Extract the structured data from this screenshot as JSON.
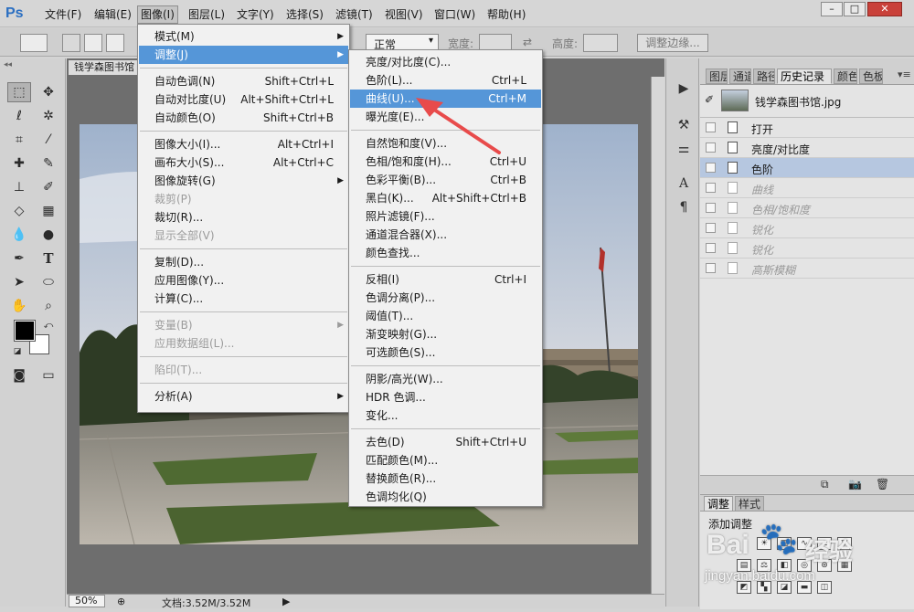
{
  "app": {
    "logo": "Ps"
  },
  "menubar": {
    "items": [
      "文件(F)",
      "编辑(E)",
      "图像(I)",
      "图层(L)",
      "文字(Y)",
      "选择(S)",
      "滤镜(T)",
      "视图(V)",
      "窗口(W)",
      "帮助(H)"
    ],
    "active": "图像(I)"
  },
  "window_controls": {
    "minimize": "–",
    "maximize": "□",
    "close": "✕"
  },
  "options_bar": {
    "style_value": "正常",
    "width_label": "宽度:",
    "height_label": "高度:",
    "refine_edge": "调整边缘..."
  },
  "document": {
    "tab_title": "钱学森图书馆",
    "zoom": "50%",
    "doc_info": "文档:3.52M/3.52M"
  },
  "image_menu": {
    "items": [
      {
        "label": "模式(M)",
        "submenu": true
      },
      {
        "label": "调整(J)",
        "submenu": true,
        "highlighted": true
      },
      {
        "separator": true
      },
      {
        "label": "自动色调(N)",
        "shortcut": "Shift+Ctrl+L"
      },
      {
        "label": "自动对比度(U)",
        "shortcut": "Alt+Shift+Ctrl+L"
      },
      {
        "label": "自动颜色(O)",
        "shortcut": "Shift+Ctrl+B"
      },
      {
        "separator": true
      },
      {
        "label": "图像大小(I)...",
        "shortcut": "Alt+Ctrl+I"
      },
      {
        "label": "画布大小(S)...",
        "shortcut": "Alt+Ctrl+C"
      },
      {
        "label": "图像旋转(G)",
        "submenu": true
      },
      {
        "label": "裁剪(P)",
        "disabled": true
      },
      {
        "label": "裁切(R)..."
      },
      {
        "label": "显示全部(V)",
        "disabled": true
      },
      {
        "separator": true
      },
      {
        "label": "复制(D)..."
      },
      {
        "label": "应用图像(Y)..."
      },
      {
        "label": "计算(C)..."
      },
      {
        "separator": true
      },
      {
        "label": "变量(B)",
        "submenu": true,
        "disabled": true
      },
      {
        "label": "应用数据组(L)...",
        "disabled": true
      },
      {
        "separator": true
      },
      {
        "label": "陷印(T)...",
        "disabled": true
      },
      {
        "separator": true
      },
      {
        "label": "分析(A)",
        "submenu": true
      }
    ]
  },
  "adjust_menu": {
    "items": [
      {
        "label": "亮度/对比度(C)..."
      },
      {
        "label": "色阶(L)...",
        "shortcut": "Ctrl+L"
      },
      {
        "label": "曲线(U)...",
        "shortcut": "Ctrl+M",
        "highlighted": true
      },
      {
        "label": "曝光度(E)..."
      },
      {
        "separator": true
      },
      {
        "label": "自然饱和度(V)..."
      },
      {
        "label": "色相/饱和度(H)...",
        "shortcut": "Ctrl+U"
      },
      {
        "label": "色彩平衡(B)...",
        "shortcut": "Ctrl+B"
      },
      {
        "label": "黑白(K)...",
        "shortcut": "Alt+Shift+Ctrl+B"
      },
      {
        "label": "照片滤镜(F)..."
      },
      {
        "label": "通道混合器(X)..."
      },
      {
        "label": "颜色查找..."
      },
      {
        "separator": true
      },
      {
        "label": "反相(I)",
        "shortcut": "Ctrl+I"
      },
      {
        "label": "色调分离(P)..."
      },
      {
        "label": "阈值(T)..."
      },
      {
        "label": "渐变映射(G)..."
      },
      {
        "label": "可选颜色(S)..."
      },
      {
        "separator": true
      },
      {
        "label": "阴影/高光(W)..."
      },
      {
        "label": "HDR 色调..."
      },
      {
        "label": "变化..."
      },
      {
        "separator": true
      },
      {
        "label": "去色(D)",
        "shortcut": "Shift+Ctrl+U"
      },
      {
        "label": "匹配颜色(M)..."
      },
      {
        "label": "替换颜色(R)..."
      },
      {
        "label": "色调均化(Q)"
      }
    ]
  },
  "history_panel": {
    "tabs": [
      "图层",
      "通道",
      "路径",
      "历史记录",
      "颜色",
      "色板"
    ],
    "active_tab": "历史记录",
    "snapshot": "钱学森图书馆.jpg",
    "states": [
      {
        "label": "打开"
      },
      {
        "label": "亮度/对比度"
      },
      {
        "label": "色阶",
        "current": true
      },
      {
        "label": "曲线",
        "undone": true
      },
      {
        "label": "色相/饱和度",
        "undone": true
      },
      {
        "label": "锐化",
        "undone": true
      },
      {
        "label": "锐化",
        "undone": true
      },
      {
        "label": "高斯模糊",
        "undone": true
      }
    ]
  },
  "adjustments_panel": {
    "tabs": [
      "调整",
      "样式"
    ],
    "title": "添加调整"
  },
  "watermark": {
    "logo": "Bai",
    "text": "经验",
    "url": "jingyan.baidu.com"
  },
  "colors": {
    "highlight": "#5596d8",
    "history_current": "#b6c7e0",
    "annotation_arrow": "#e84b4b",
    "ps_blue": "#2b6fc2"
  }
}
